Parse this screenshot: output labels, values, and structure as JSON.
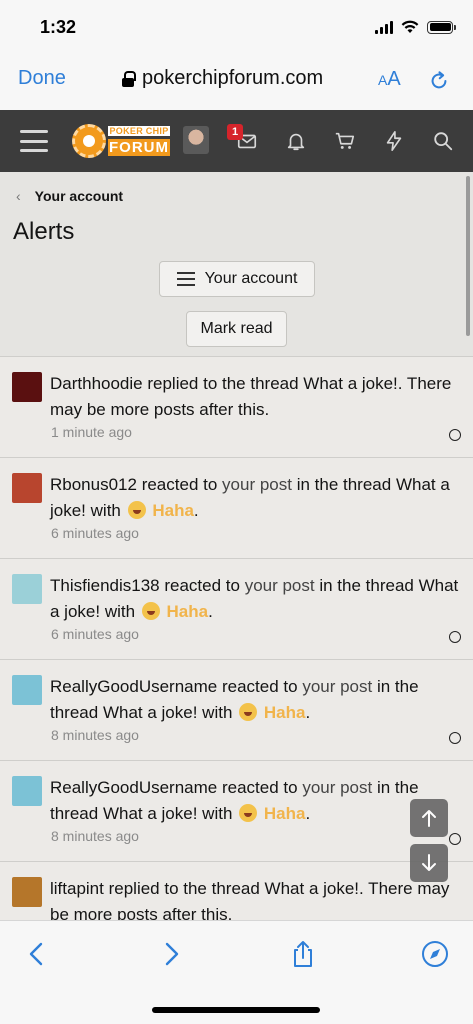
{
  "status_bar": {
    "time": "1:32"
  },
  "browser": {
    "done_label": "Done",
    "url": "pokerchipforum.com",
    "text_size_label_small": "A",
    "text_size_label_large": "A"
  },
  "forum_nav": {
    "logo_top": "POKER CHIP",
    "logo_bottom": "FORUM",
    "inbox_badge": "1"
  },
  "page": {
    "breadcrumb": "Your account",
    "title": "Alerts",
    "account_button": "Your account",
    "mark_read_button": "Mark read"
  },
  "alerts": [
    {
      "user": "Darthhoodie",
      "action": " replied to the thread ",
      "thread": "What a joke!",
      "suffix": ". There may be more posts after this.",
      "time": "1 minute ago",
      "avatar_color": "#5a1010"
    },
    {
      "user": "Rbonus012",
      "action": " reacted to ",
      "post": "your post",
      "mid": " in the thread ",
      "thread": "What a joke!",
      "with": " with ",
      "reaction": "Haha",
      "end": ".",
      "time": "6 minutes ago",
      "avatar_color": "#b8452e"
    },
    {
      "user": "Thisfiendis138",
      "action": " reacted to ",
      "post": "your post",
      "mid": " in the thread ",
      "thread": "What a joke!",
      "with": " with ",
      "reaction": "Haha",
      "end": ".",
      "time": "6 minutes ago",
      "avatar_color": "#9bd0d8"
    },
    {
      "user": "ReallyGoodUsername",
      "action": " reacted to ",
      "post": "your post",
      "mid": " in the thread ",
      "thread": "What a joke!",
      "with": " with ",
      "reaction": "Haha",
      "end": ".",
      "time": "8 minutes ago",
      "avatar_color": "#7cc2d6"
    },
    {
      "user": "ReallyGoodUsername",
      "action": " reacted to ",
      "post": "your post",
      "mid": " in the thread ",
      "thread": "What a joke!",
      "with": " with ",
      "reaction": "Haha",
      "end": ".",
      "time": "8 minutes ago",
      "avatar_color": "#7cc2d6"
    },
    {
      "user": "liftapint",
      "action": " replied to the thread ",
      "thread": "What a joke!",
      "suffix": ". There may be more posts after this.",
      "time": "",
      "avatar_color": "#b5762a"
    }
  ],
  "colors": {
    "safari_blue": "#2f7fd8",
    "forum_nav_bg": "#3c3c3c",
    "brand_orange": "#f29a1d",
    "reaction_color": "#f1b44b"
  }
}
